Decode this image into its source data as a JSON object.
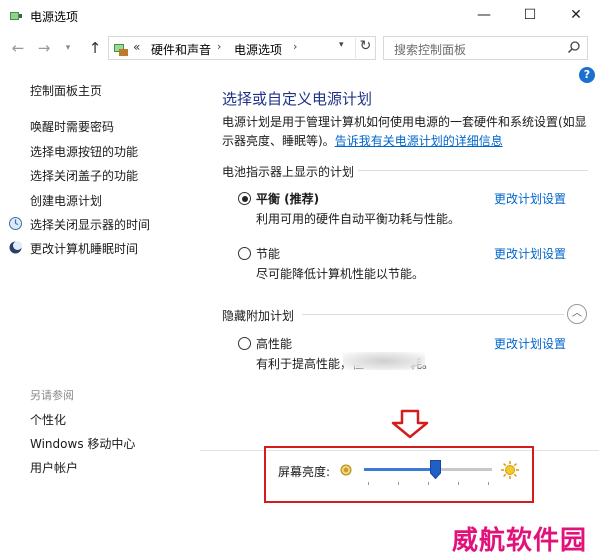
{
  "window": {
    "title": "电源选项",
    "min_glyph": "—",
    "max_glyph": "☐",
    "close_glyph": "✕"
  },
  "nav": {
    "back_glyph": "←",
    "forward_glyph": "→",
    "dropdown_glyph": "▾",
    "up_glyph": "↑",
    "chevron": "«",
    "breadcrumb_1": "硬件和声音",
    "breadcrumb_sep": "›",
    "breadcrumb_2": "电源选项",
    "addr_dropdown_glyph": "▾",
    "refresh_glyph": "↻",
    "search_placeholder": "搜索控制面板"
  },
  "help_glyph": "?",
  "sidebar": {
    "home": "控制面板主页",
    "items": [
      "唤醒时需要密码",
      "选择电源按钮的功能",
      "选择关闭盖子的功能",
      "创建电源计划",
      "选择关闭显示器的时间",
      "更改计算机睡眠时间"
    ],
    "see_also_title": "另请参阅",
    "see_also": [
      "个性化",
      "Windows 移动中心",
      "用户帐户"
    ]
  },
  "main": {
    "heading": "选择或自定义电源计划",
    "desc_text": "电源计划是用于管理计算机如何使用电源的一套硬件和系统设置(如显示器亮度、睡眠等)。",
    "desc_link": "告诉我有关电源计划的详细信息",
    "group1_title": "电池指示器上显示的计划",
    "plans": [
      {
        "name": "平衡 (推荐)",
        "desc": "利用可用的硬件自动平衡功耗与性能。",
        "link": "更改计划设置",
        "selected": true
      },
      {
        "name": "节能",
        "desc": "尽可能降低计算机性能以节能。",
        "link": "更改计划设置",
        "selected": false
      }
    ],
    "group2_title": "隐藏附加计划",
    "collapse_glyph": "︿",
    "hidden_plans": [
      {
        "name": "高性能",
        "desc_start": "有利于提高性能，但",
        "desc_end": "耗。",
        "link": "更改计划设置",
        "selected": false
      }
    ]
  },
  "brightness": {
    "label": "屏幕亮度:",
    "level_fraction": 0.56
  },
  "colors": {
    "link": "#0066cc",
    "heading": "#1e3287",
    "annotation_red": "#d41c1c",
    "watermark": "#e2127a"
  },
  "watermark": "威航软件园"
}
